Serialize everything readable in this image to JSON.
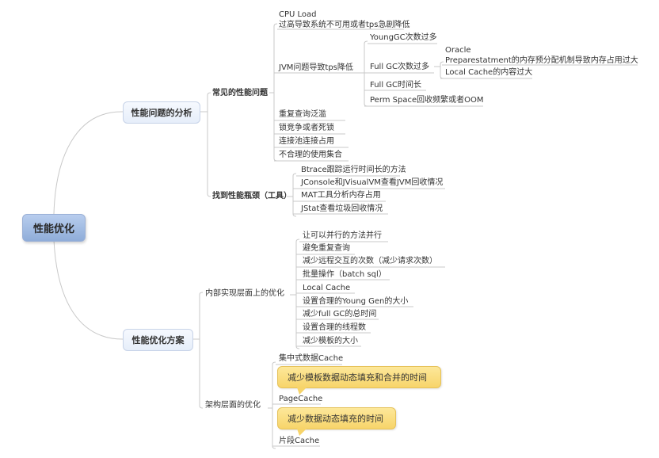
{
  "root": {
    "label": "性能优化"
  },
  "branches": [
    {
      "label": "性能问题的分析",
      "children": [
        {
          "label": "常见的性能问题",
          "children": [
            {
              "label_lines": [
                "CPU Load",
                "过高导致系统不可用或者tps急剧降低"
              ]
            },
            {
              "label": "JVM问题导致tps降低",
              "children": [
                {
                  "label": "YoungGC次数过多"
                },
                {
                  "label": "Full GC次数过多",
                  "children": [
                    {
                      "label_lines": [
                        "Oracle",
                        "Preparestatment的内存预分配机制导致内存占用过大"
                      ]
                    },
                    {
                      "label": "Local Cache的内容过大"
                    }
                  ]
                },
                {
                  "label": "Full GC时间长"
                },
                {
                  "label": "Perm Space回收频繁或者OOM"
                }
              ]
            },
            {
              "label": "重复查询泛滥"
            },
            {
              "label": "锁竞争或者死锁"
            },
            {
              "label": "连接池连接占用"
            },
            {
              "label": "不合理的使用集合"
            }
          ]
        },
        {
          "label": "找到性能瓶颈（工具）",
          "children": [
            {
              "label": "Btrace跟踪运行时间长的方法"
            },
            {
              "label": "JConsole和JVisualVM查看JVM回收情况"
            },
            {
              "label": "MAT工具分析内存占用"
            },
            {
              "label": "JStat查看垃圾回收情况"
            }
          ]
        }
      ]
    },
    {
      "label": "性能优化方案",
      "children": [
        {
          "label": "内部实现层面上的优化",
          "children": [
            {
              "label": "让可以并行的方法并行"
            },
            {
              "label": "避免重复查询"
            },
            {
              "label": "减少远程交互的次数（减少请求次数）"
            },
            {
              "label": "批量操作（batch sql）"
            },
            {
              "label": "Local Cache"
            },
            {
              "label": "设置合理的Young Gen的大小"
            },
            {
              "label": "减少full GC的总时间"
            },
            {
              "label": "设置合理的线程数"
            },
            {
              "label": "减少模板的大小"
            }
          ]
        },
        {
          "label": "架构层面的优化",
          "children": [
            {
              "label": "集中式数据Cache"
            },
            {
              "label": "PageCache",
              "callout": "减少模板数据动态填充和合并的时间"
            },
            {
              "label": "片段Cache",
              "callout": "减少数据动态填充的时间"
            }
          ]
        }
      ]
    }
  ],
  "colors": {
    "root_fill": "#a9c1e8",
    "main_fill": "#eef3fc",
    "callout_fill": "#f9dc7a",
    "line": "#c8c8c8"
  }
}
